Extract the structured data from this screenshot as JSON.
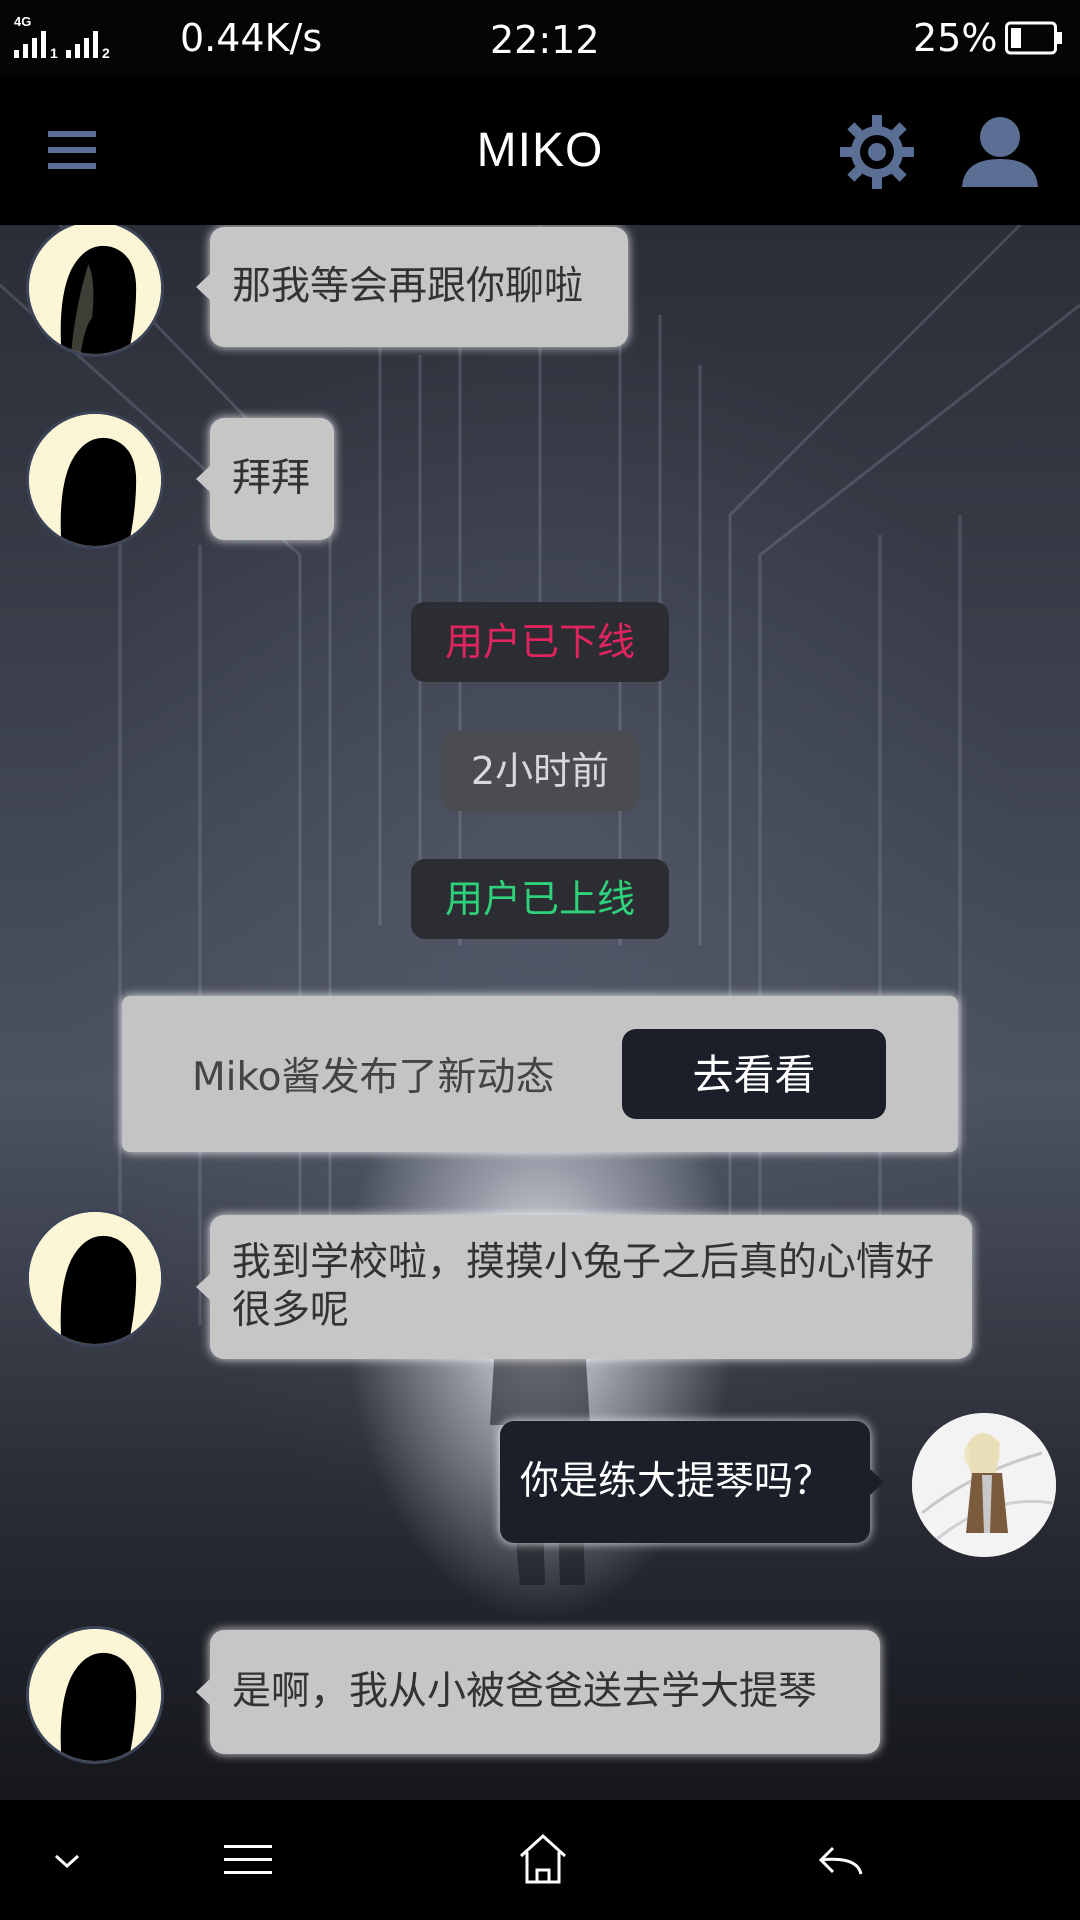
{
  "status_bar": {
    "network": "4G",
    "sim1": "1",
    "sim2": "2",
    "speed": "0.44K/s",
    "time": "22:12",
    "battery": "25%",
    "battery_level": 0.25
  },
  "header": {
    "title": "MIKO",
    "icons": [
      "menu-icon",
      "gear-icon",
      "user-icon"
    ]
  },
  "messages": [
    {
      "side": "left",
      "text": "那我等会再跟你聊啦"
    },
    {
      "side": "left",
      "text": "拜拜"
    },
    {
      "type": "system",
      "text": "用户已下线",
      "color": "#e0245e"
    },
    {
      "type": "system",
      "text": "2小时前",
      "color": "#d8d8d8"
    },
    {
      "type": "system",
      "text": "用户已上线",
      "color": "#2fd17a"
    },
    {
      "type": "notice",
      "text": "Miko酱发布了新动态",
      "button": "去看看"
    },
    {
      "side": "left",
      "text": "我到学校啦，摸摸小兔子之后真的心情好很多呢"
    },
    {
      "side": "right",
      "text": "你是练大提琴吗？"
    },
    {
      "side": "left",
      "text": "是啊，我从小被爸爸送去学大提琴"
    }
  ],
  "nav": {
    "icons": [
      "chevron-down-icon",
      "menu-lines-icon",
      "home-icon",
      "back-icon"
    ]
  },
  "colors": {
    "accent_icon": "#5b6e94",
    "bubble_left": "#c6c6c6",
    "bubble_right": "#1b1f2a"
  }
}
